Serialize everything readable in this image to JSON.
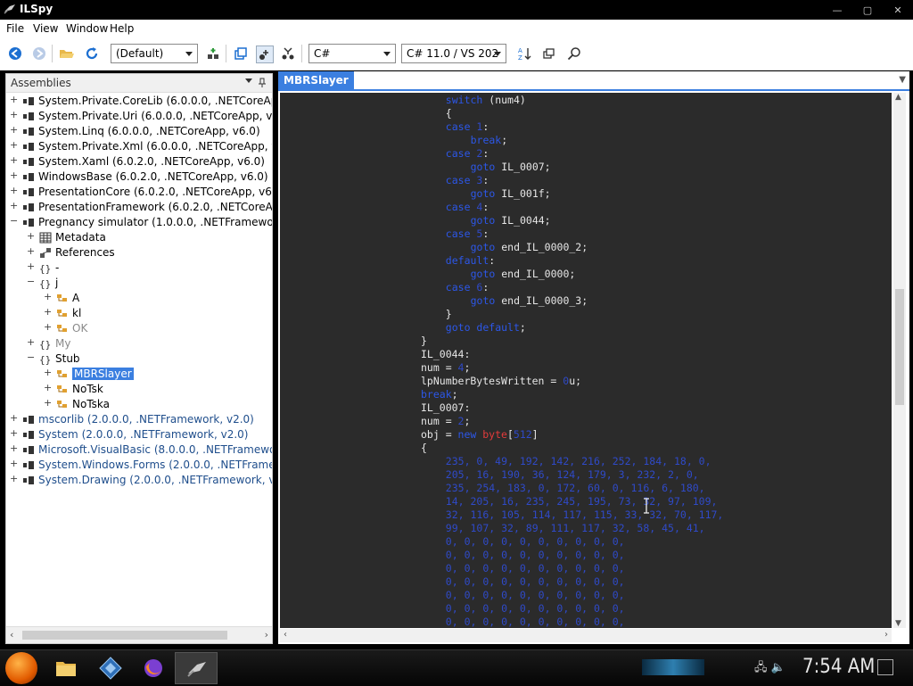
{
  "window": {
    "title": "ILSpy",
    "minimize": "—",
    "maximize": "▢",
    "close": "✕"
  },
  "menu": {
    "file": "File",
    "view": "View",
    "window": "Window",
    "help": "Help"
  },
  "toolbar": {
    "assembly_list": "(Default)",
    "language": "C#",
    "language_version": "C# 11.0 / VS 202"
  },
  "assemblies": {
    "header": "Assemblies",
    "items": [
      {
        "expander": "+",
        "text": "System.Private.CoreLib (6.0.0.0, .NETCoreApp, v6.0)",
        "style": "normal",
        "indent": 0,
        "icon": "assembly"
      },
      {
        "expander": "+",
        "text": "System.Private.Uri (6.0.0.0, .NETCoreApp, v6.0)",
        "style": "normal",
        "indent": 0,
        "icon": "assembly"
      },
      {
        "expander": "+",
        "text": "System.Linq (6.0.0.0, .NETCoreApp, v6.0)",
        "style": "normal",
        "indent": 0,
        "icon": "assembly"
      },
      {
        "expander": "+",
        "text": "System.Private.Xml (6.0.0.0, .NETCoreApp, v6.0)",
        "style": "normal",
        "indent": 0,
        "icon": "assembly"
      },
      {
        "expander": "+",
        "text": "System.Xaml (6.0.2.0, .NETCoreApp, v6.0)",
        "style": "normal",
        "indent": 0,
        "icon": "assembly"
      },
      {
        "expander": "+",
        "text": "WindowsBase (6.0.2.0, .NETCoreApp, v6.0)",
        "style": "normal",
        "indent": 0,
        "icon": "assembly"
      },
      {
        "expander": "+",
        "text": "PresentationCore (6.0.2.0, .NETCoreApp, v6.0)",
        "style": "normal",
        "indent": 0,
        "icon": "assembly"
      },
      {
        "expander": "+",
        "text": "PresentationFramework (6.0.2.0, .NETCoreApp, v6.0)",
        "style": "normal",
        "indent": 0,
        "icon": "assembly"
      },
      {
        "expander": "−",
        "text": "Pregnancy simulator (1.0.0.0, .NETFramework, v4.0)",
        "style": "normal",
        "indent": 0,
        "icon": "assembly"
      },
      {
        "expander": "+",
        "text": "Metadata",
        "style": "normal",
        "indent": 1,
        "icon": "metadata"
      },
      {
        "expander": "+",
        "text": "References",
        "style": "normal",
        "indent": 1,
        "icon": "references"
      },
      {
        "expander": "+",
        "text": "-",
        "style": "normal",
        "indent": 1,
        "icon": "namespace"
      },
      {
        "expander": "−",
        "text": "j",
        "style": "normal",
        "indent": 1,
        "icon": "namespace"
      },
      {
        "expander": "+",
        "text": "A",
        "style": "normal",
        "indent": 2,
        "icon": "class"
      },
      {
        "expander": "+",
        "text": "kl",
        "style": "normal",
        "indent": 2,
        "icon": "class"
      },
      {
        "expander": "+",
        "text": "OK",
        "style": "gray",
        "indent": 2,
        "icon": "class-internal"
      },
      {
        "expander": "+",
        "text": "My",
        "style": "gray",
        "indent": 1,
        "icon": "namespace"
      },
      {
        "expander": "−",
        "text": "Stub",
        "style": "normal",
        "indent": 1,
        "icon": "namespace"
      },
      {
        "expander": "+",
        "text": "MBRSlayer",
        "style": "selected",
        "indent": 2,
        "icon": "class"
      },
      {
        "expander": "+",
        "text": "NoTsk",
        "style": "normal",
        "indent": 2,
        "icon": "class"
      },
      {
        "expander": "+",
        "text": "NoTska",
        "style": "normal",
        "indent": 2,
        "icon": "class"
      },
      {
        "expander": "+",
        "text": "mscorlib (2.0.0.0, .NETFramework, v2.0)",
        "style": "blue",
        "indent": 0,
        "icon": "assembly-old"
      },
      {
        "expander": "+",
        "text": "System (2.0.0.0, .NETFramework, v2.0)",
        "style": "blue",
        "indent": 0,
        "icon": "assembly-old"
      },
      {
        "expander": "+",
        "text": "Microsoft.VisualBasic (8.0.0.0, .NETFramework, v2.0)",
        "style": "blue",
        "indent": 0,
        "icon": "assembly-old"
      },
      {
        "expander": "+",
        "text": "System.Windows.Forms (2.0.0.0, .NETFramework, v2.0)",
        "style": "blue",
        "indent": 0,
        "icon": "assembly-old"
      },
      {
        "expander": "+",
        "text": "System.Drawing (2.0.0.0, .NETFramework, v2.0)",
        "style": "blue",
        "indent": 0,
        "icon": "assembly-old"
      }
    ]
  },
  "document": {
    "tab": "MBRSlayer",
    "code": [
      {
        "indent": 8,
        "tokens": [
          [
            "switch",
            "kw"
          ],
          [
            " (num4)",
            "plain"
          ]
        ]
      },
      {
        "indent": 8,
        "tokens": [
          [
            "{",
            "plain"
          ]
        ]
      },
      {
        "indent": 8,
        "tokens": [
          [
            "case ",
            "kw"
          ],
          [
            "1",
            "num"
          ],
          [
            ":",
            "plain"
          ]
        ]
      },
      {
        "indent": 12,
        "tokens": [
          [
            "break",
            "kw"
          ],
          [
            ";",
            "plain"
          ]
        ]
      },
      {
        "indent": 8,
        "tokens": [
          [
            "case ",
            "kw"
          ],
          [
            "2",
            "num"
          ],
          [
            ":",
            "plain"
          ]
        ]
      },
      {
        "indent": 12,
        "tokens": [
          [
            "goto",
            "kw"
          ],
          [
            " IL_0007;",
            "plain"
          ]
        ]
      },
      {
        "indent": 8,
        "tokens": [
          [
            "case ",
            "kw"
          ],
          [
            "3",
            "num"
          ],
          [
            ":",
            "plain"
          ]
        ]
      },
      {
        "indent": 12,
        "tokens": [
          [
            "goto",
            "kw"
          ],
          [
            " IL_001f;",
            "plain"
          ]
        ]
      },
      {
        "indent": 8,
        "tokens": [
          [
            "case ",
            "kw"
          ],
          [
            "4",
            "num"
          ],
          [
            ":",
            "plain"
          ]
        ]
      },
      {
        "indent": 12,
        "tokens": [
          [
            "goto",
            "kw"
          ],
          [
            " IL_0044;",
            "plain"
          ]
        ]
      },
      {
        "indent": 8,
        "tokens": [
          [
            "case ",
            "kw"
          ],
          [
            "5",
            "num"
          ],
          [
            ":",
            "plain"
          ]
        ]
      },
      {
        "indent": 12,
        "tokens": [
          [
            "goto",
            "kw"
          ],
          [
            " end_IL_0000_2;",
            "plain"
          ]
        ]
      },
      {
        "indent": 8,
        "tokens": [
          [
            "default",
            "kw"
          ],
          [
            ":",
            "plain"
          ]
        ]
      },
      {
        "indent": 12,
        "tokens": [
          [
            "goto",
            "kw"
          ],
          [
            " end_IL_0000;",
            "plain"
          ]
        ]
      },
      {
        "indent": 8,
        "tokens": [
          [
            "case ",
            "kw"
          ],
          [
            "6",
            "num"
          ],
          [
            ":",
            "plain"
          ]
        ]
      },
      {
        "indent": 12,
        "tokens": [
          [
            "goto",
            "kw"
          ],
          [
            " end_IL_0000_3;",
            "plain"
          ]
        ]
      },
      {
        "indent": 8,
        "tokens": [
          [
            "}",
            "plain"
          ]
        ]
      },
      {
        "indent": 8,
        "tokens": [
          [
            "goto ",
            "kw"
          ],
          [
            "default",
            "kw"
          ],
          [
            ";",
            "plain"
          ]
        ]
      },
      {
        "indent": 4,
        "tokens": [
          [
            "}",
            "plain"
          ]
        ]
      },
      {
        "indent": 4,
        "tokens": [
          [
            "IL_0044:",
            "plain"
          ]
        ]
      },
      {
        "indent": 4,
        "tokens": [
          [
            "num = ",
            "plain"
          ],
          [
            "4",
            "num"
          ],
          [
            ";",
            "plain"
          ]
        ]
      },
      {
        "indent": 4,
        "tokens": [
          [
            "lpNumberBytesWritten = ",
            "plain"
          ],
          [
            "0",
            "num"
          ],
          [
            "u;",
            "plain"
          ]
        ]
      },
      {
        "indent": 4,
        "tokens": [
          [
            "break",
            "kw"
          ],
          [
            ";",
            "plain"
          ]
        ]
      },
      {
        "indent": 4,
        "tokens": [
          [
            "IL_0007:",
            "plain"
          ]
        ]
      },
      {
        "indent": 4,
        "tokens": [
          [
            "num = ",
            "plain"
          ],
          [
            "2",
            "num"
          ],
          [
            ";",
            "plain"
          ]
        ]
      },
      {
        "indent": 4,
        "tokens": [
          [
            "obj = ",
            "plain"
          ],
          [
            "new ",
            "kw"
          ],
          [
            "byte",
            "red"
          ],
          [
            "[",
            "plain"
          ],
          [
            "512",
            "num"
          ],
          [
            "]",
            "plain"
          ]
        ]
      },
      {
        "indent": 4,
        "tokens": [
          [
            "{",
            "plain"
          ]
        ]
      },
      {
        "indent": 8,
        "tokens": [
          [
            "235, 0, 49, 192, 142, 216, 252, 184, 18, 0,",
            "num"
          ]
        ]
      },
      {
        "indent": 8,
        "tokens": [
          [
            "205, 16, 190, 36, 124, 179, 3, 232, 2, 0,",
            "num"
          ]
        ]
      },
      {
        "indent": 8,
        "tokens": [
          [
            "235, 254, 183, 0, 172, 60, 0, 116, 6, 180,",
            "num"
          ]
        ]
      },
      {
        "indent": 8,
        "tokens": [
          [
            "14, 205, 16, 235, 245, 195, 73, 32, 97, 109,",
            "num"
          ]
        ]
      },
      {
        "indent": 8,
        "tokens": [
          [
            "32, 116, 105, 114, 117, 115, 33, 32, 70, 117,",
            "num"
          ]
        ]
      },
      {
        "indent": 8,
        "tokens": [
          [
            "99, 107, 32, 89, 111, 117, 32, 58, 45, 41,",
            "num"
          ]
        ]
      },
      {
        "indent": 8,
        "tokens": [
          [
            "0, 0, 0, 0, 0, 0, 0, 0, 0, 0,",
            "num"
          ]
        ]
      },
      {
        "indent": 8,
        "tokens": [
          [
            "0, 0, 0, 0, 0, 0, 0, 0, 0, 0,",
            "num"
          ]
        ]
      },
      {
        "indent": 8,
        "tokens": [
          [
            "0, 0, 0, 0, 0, 0, 0, 0, 0, 0,",
            "num"
          ]
        ]
      },
      {
        "indent": 8,
        "tokens": [
          [
            "0, 0, 0, 0, 0, 0, 0, 0, 0, 0,",
            "num"
          ]
        ]
      },
      {
        "indent": 8,
        "tokens": [
          [
            "0, 0, 0, 0, 0, 0, 0, 0, 0, 0,",
            "num"
          ]
        ]
      },
      {
        "indent": 8,
        "tokens": [
          [
            "0, 0, 0, 0, 0, 0, 0, 0, 0, 0,",
            "num"
          ]
        ]
      },
      {
        "indent": 8,
        "tokens": [
          [
            "0, 0, 0, 0, 0, 0, 0, 0, 0, 0,",
            "num"
          ]
        ]
      }
    ]
  },
  "taskbar": {
    "clock": "7:54 AM"
  },
  "colors": {
    "selection": "#3b7fe0",
    "keyword": "#2c57e8",
    "number": "#2f4ac8",
    "type": "#e33b3b",
    "code_bg": "#2b2b2b"
  }
}
